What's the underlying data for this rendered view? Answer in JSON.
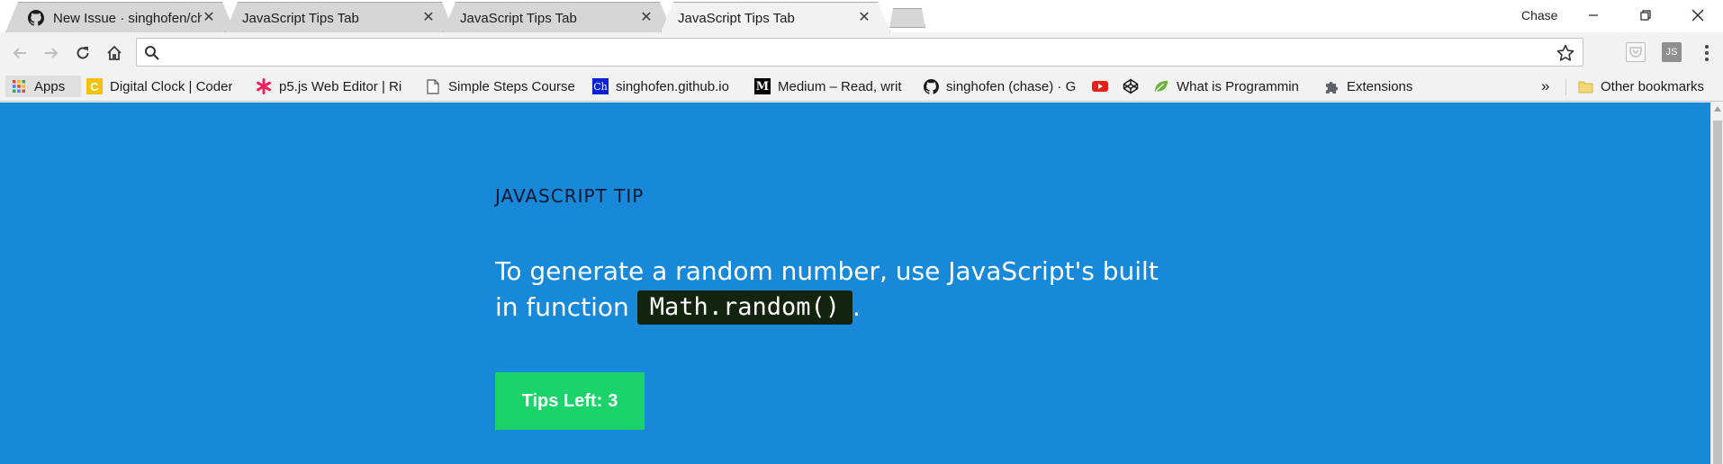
{
  "browser": {
    "tabs": [
      {
        "title": "New Issue · singhofen/chase",
        "favicon": "github-icon",
        "active": false
      },
      {
        "title": "JavaScript Tips Tab",
        "favicon": "",
        "active": false
      },
      {
        "title": "JavaScript Tips Tab",
        "favicon": "",
        "active": false
      },
      {
        "title": "JavaScript Tips Tab",
        "favicon": "",
        "active": true
      }
    ],
    "profile_name": "Chase",
    "omnibox": {
      "value": "",
      "placeholder": ""
    },
    "extension_labels": {
      "js": "JS"
    }
  },
  "bookmarks": {
    "items": [
      {
        "label": "Apps",
        "icon": "apps-grid-icon"
      },
      {
        "label": "Digital Clock | Coder",
        "icon": "c-letter-icon"
      },
      {
        "label": "p5.js Web Editor | Ri",
        "icon": "asterisk-icon"
      },
      {
        "label": "Simple Steps Course",
        "icon": "page-icon"
      },
      {
        "label": "singhofen.github.io",
        "icon": "ch-icon"
      },
      {
        "label": "Medium – Read, writ",
        "icon": "medium-icon"
      },
      {
        "label": "singhofen (chase) · G",
        "icon": "github-icon"
      },
      {
        "label": "",
        "icon": "youtube-icon"
      },
      {
        "label": "",
        "icon": "codepen-icon"
      },
      {
        "label": "What is Programmin",
        "icon": "leaf-icon"
      },
      {
        "label": "Extensions",
        "icon": "puzzle-icon"
      }
    ],
    "overflow": "»",
    "other_bookmarks": "Other bookmarks",
    "icon_letters": {
      "clock": "C",
      "singhofen": "Ch",
      "medium": "M"
    }
  },
  "content": {
    "heading": "JAVASCRIPT TIP",
    "tip_text_before": "To generate a random number, use JavaScript's built in function",
    "tip_code": "Math.random()",
    "tip_text_after": ".",
    "tips_button_label": "Tips Left:",
    "tips_left": "3"
  },
  "colors": {
    "page_background": "#1789d8",
    "button_background": "#1ad36a",
    "code_background": "#13250f",
    "heading_color": "#0a1730"
  }
}
